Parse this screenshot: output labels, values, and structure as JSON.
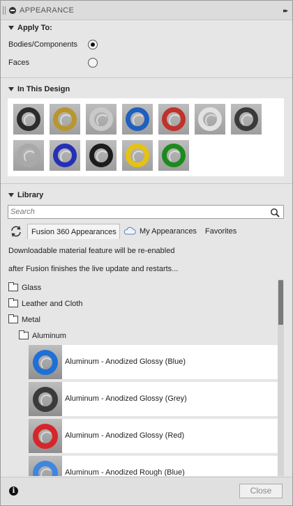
{
  "title": "APPEARANCE",
  "apply_to": {
    "header": "Apply To:",
    "options": [
      {
        "label": "Bodies/Components",
        "checked": true
      },
      {
        "label": "Faces",
        "checked": false
      }
    ]
  },
  "in_this_design": {
    "header": "In This Design",
    "swatches": [
      {
        "name": "black-chrome",
        "color": "#2b2b2b"
      },
      {
        "name": "gold",
        "color": "#b8962e"
      },
      {
        "name": "silver",
        "color": "#c9c9c9"
      },
      {
        "name": "blue",
        "color": "#1f5fbf"
      },
      {
        "name": "red",
        "color": "#c0322a"
      },
      {
        "name": "clear-glass",
        "color": "#e2e2e2"
      },
      {
        "name": "dark-grey",
        "color": "#3a3a3a"
      },
      {
        "name": "smoke-glass",
        "color": "#a9a9a9"
      },
      {
        "name": "deep-blue",
        "color": "#2430b8"
      },
      {
        "name": "black",
        "color": "#1c1c1c"
      },
      {
        "name": "yellow",
        "color": "#e6c214"
      },
      {
        "name": "green",
        "color": "#1c8a1c"
      }
    ]
  },
  "library": {
    "header": "Library",
    "search_placeholder": "Search",
    "tabs": [
      "Fusion 360 Appearances",
      "My Appearances",
      "Favorites"
    ],
    "notice_lines": [
      "Downloadable material feature will be re-enabled",
      "after Fusion finishes the live update and restarts..."
    ],
    "folders": [
      "Glass",
      "Leather and Cloth",
      "Metal"
    ],
    "subfolder": "Aluminum",
    "materials": [
      {
        "label": "Aluminum - Anodized Glossy (Blue)",
        "color": "#1f6fd6"
      },
      {
        "label": "Aluminum - Anodized Glossy (Grey)",
        "color": "#3a3a3a"
      },
      {
        "label": "Aluminum - Anodized Glossy (Red)",
        "color": "#d6262a"
      },
      {
        "label": "Aluminum - Anodized Rough (Blue)",
        "color": "#3f86e0"
      }
    ]
  },
  "footer": {
    "info_symbol": "i",
    "close_label": "Close"
  }
}
